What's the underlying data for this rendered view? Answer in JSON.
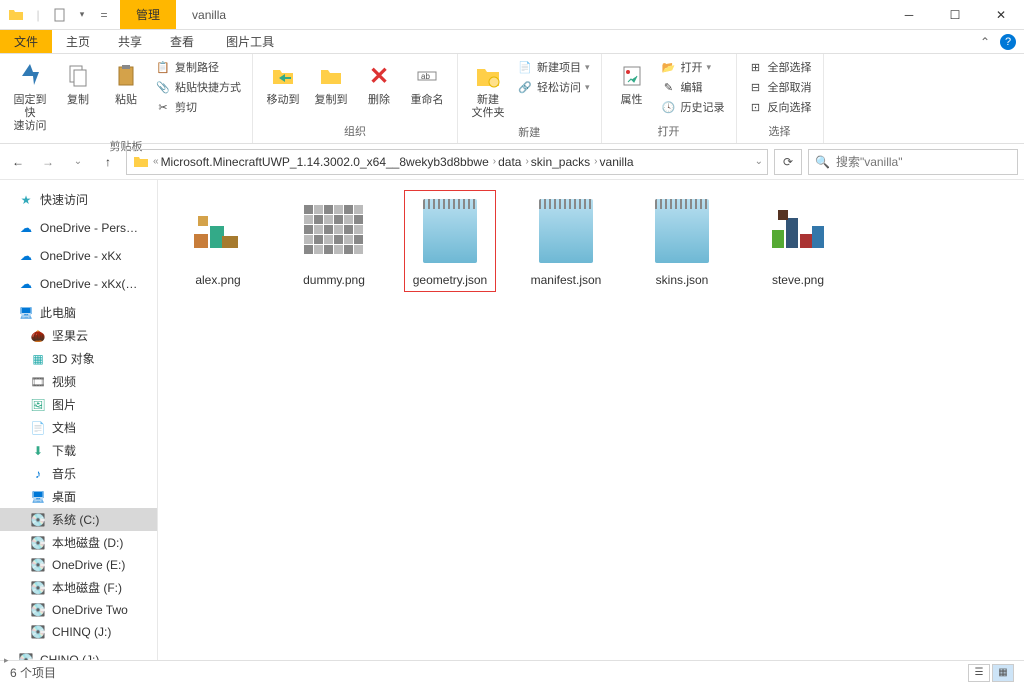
{
  "window": {
    "title": "vanilla",
    "context_tab": "管理"
  },
  "tabs": {
    "file": "文件",
    "home": "主页",
    "share": "共享",
    "view": "查看",
    "pictools": "图片工具"
  },
  "ribbon": {
    "pin": "固定到快\n速访问",
    "copy": "复制",
    "paste": "粘贴",
    "copypath": "复制路径",
    "pasteshortcut": "粘贴快捷方式",
    "cut": "剪切",
    "clipboard_label": "剪贴板",
    "moveto": "移动到",
    "copyto": "复制到",
    "delete": "删除",
    "rename": "重命名",
    "organize_label": "组织",
    "newfolder": "新建\n文件夹",
    "newitem": "新建项目",
    "easyaccess": "轻松访问",
    "new_label": "新建",
    "properties": "属性",
    "open": "打开",
    "edit": "编辑",
    "history": "历史记录",
    "open_label": "打开",
    "selectall": "全部选择",
    "selectnone": "全部取消",
    "invertsel": "反向选择",
    "select_label": "选择"
  },
  "breadcrumb": [
    "Microsoft.MinecraftUWP_1.14.3002.0_x64__8wekyb3d8bbwe",
    "data",
    "skin_packs",
    "vanilla"
  ],
  "search_placeholder": "搜索\"vanilla\"",
  "sidebar": {
    "quick": "快速访问",
    "od_personal": "OneDrive - Pers…",
    "od_xkx": "OneDrive - xKx",
    "od_xkx2": "OneDrive - xKx(…",
    "thispc": "此电脑",
    "items": [
      "坚果云",
      "3D 对象",
      "视频",
      "图片",
      "文档",
      "下载",
      "音乐",
      "桌面"
    ],
    "drives": [
      "系统 (C:)",
      "本地磁盘 (D:)",
      "OneDrive (E:)",
      "本地磁盘 (F:)",
      "OneDrive Two",
      "CHINQ (J:)"
    ],
    "removable": "CHINQ (J:)"
  },
  "files": [
    {
      "name": "alex.png",
      "type": "image",
      "selected": false
    },
    {
      "name": "dummy.png",
      "type": "image-gray",
      "selected": false
    },
    {
      "name": "geometry.json",
      "type": "json",
      "selected": true
    },
    {
      "name": "manifest.json",
      "type": "json",
      "selected": false
    },
    {
      "name": "skins.json",
      "type": "json",
      "selected": false
    },
    {
      "name": "steve.png",
      "type": "image-dark",
      "selected": false
    }
  ],
  "status": "6 个项目"
}
